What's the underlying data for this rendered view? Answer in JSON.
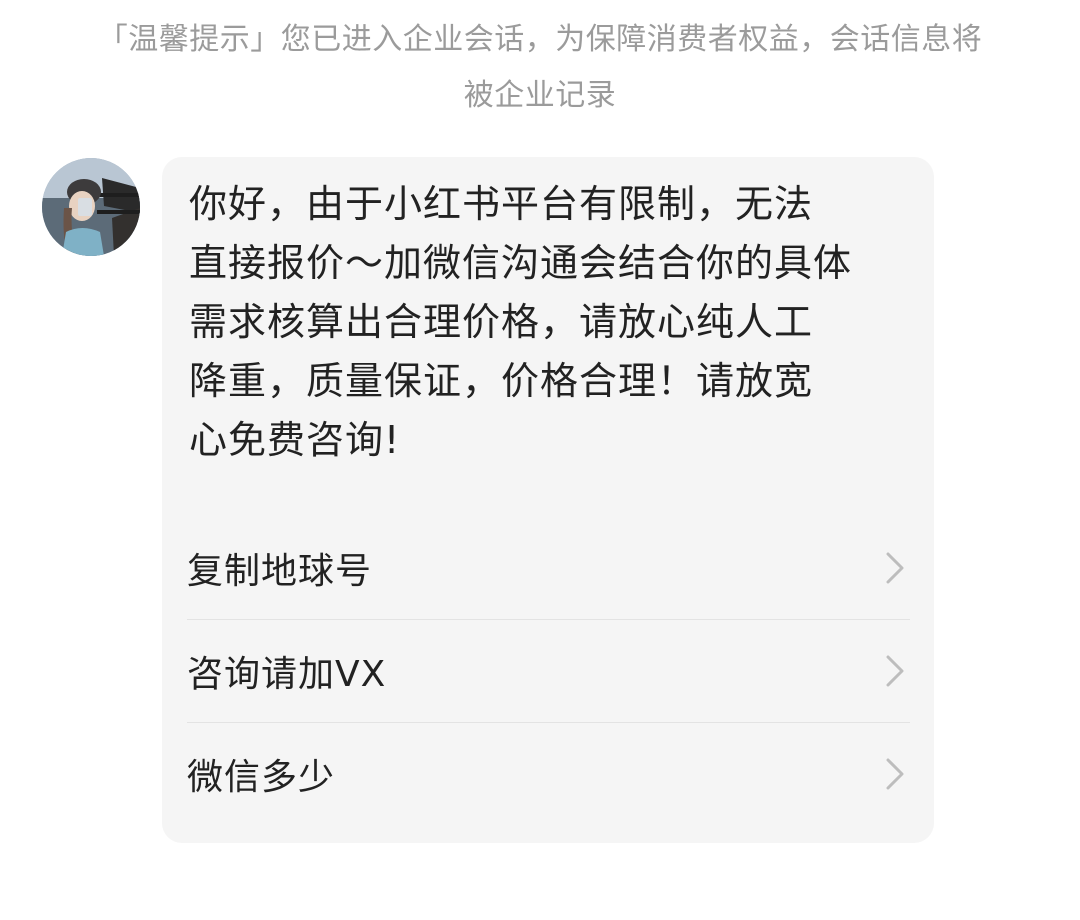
{
  "notice": {
    "line1": "「温馨提示」您已进入企业会话，为保障消费者权益，会话信息将",
    "line2": "被企业记录"
  },
  "message": {
    "lines": [
      "你好，由于小红书平台有限制，无法",
      "直接报价～加微信沟通会结合你的具体",
      "需求核算出合理价格，请放心纯人工",
      "降重，质量保证，价格合理！请放宽",
      "心免费咨询!"
    ]
  },
  "menu": {
    "items": [
      {
        "label": "复制地球号",
        "icon": "chevron-right-icon"
      },
      {
        "label": "咨询请加VX",
        "icon": "chevron-right-icon"
      },
      {
        "label": "微信多少",
        "icon": "chevron-right-icon"
      }
    ]
  },
  "colors": {
    "notice_text": "#9b9b9b",
    "bubble_bg": "#f5f5f5",
    "text": "#222222",
    "divider": "#e3e3e3",
    "chevron": "#bdbdbd"
  }
}
